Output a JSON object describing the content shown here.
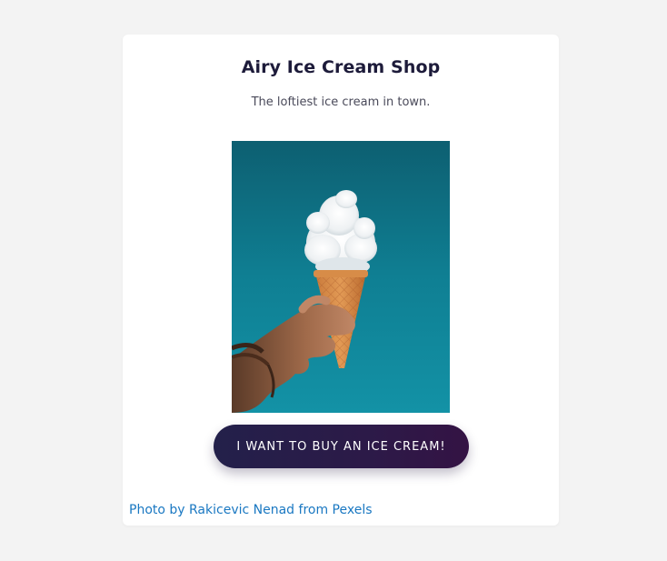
{
  "shop": {
    "title": "Airy Ice Cream Shop",
    "tagline": "The loftiest ice cream in town."
  },
  "hero_image": {
    "icon": "ice-cream-cone-photo",
    "background_color": "#0f7f93"
  },
  "buy_button": {
    "label": "I WANT TO BUY AN ICE CREAM!"
  },
  "photo_credit": {
    "text": "Photo by Rakicevic Nenad from Pexels"
  },
  "colors": {
    "page_background": "#f3f3f3",
    "card_background": "#ffffff",
    "title": "#1d1b3a",
    "button_start": "#23204a",
    "button_end": "#341344",
    "link": "#1a78c2"
  }
}
